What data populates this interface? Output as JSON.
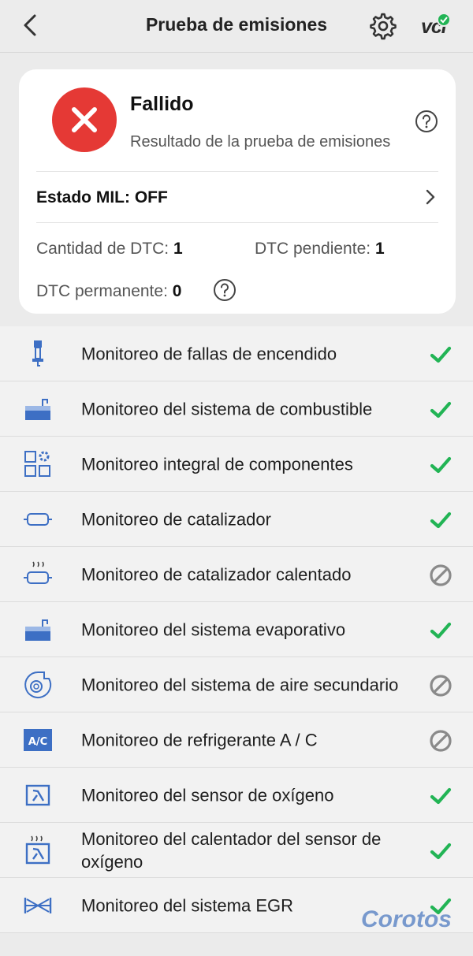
{
  "header": {
    "title": "Prueba de emisiones",
    "vci_label": "vci",
    "vci_status_color": "#22b455"
  },
  "summary": {
    "result_title": "Fallido",
    "result_subtitle": "Resultado de la prueba de emisiones",
    "result_color": "#e53935",
    "mil_status": "Estado MIL: OFF",
    "dtc_count_label": "Cantidad de DTC:",
    "dtc_count_value": "1",
    "dtc_pending_label": "DTC pendiente:",
    "dtc_pending_value": "1",
    "dtc_permanent_label": "DTC permanente:",
    "dtc_permanent_value": "0"
  },
  "monitors": [
    {
      "label": "Monitoreo de fallas de encendido",
      "icon": "spark-plug-icon",
      "status": "complete"
    },
    {
      "label": "Monitoreo del sistema de combustible",
      "icon": "fuel-system-icon",
      "status": "complete"
    },
    {
      "label": "Monitoreo integral de componentes",
      "icon": "components-icon",
      "status": "complete"
    },
    {
      "label": "Monitoreo de catalizador",
      "icon": "catalyst-icon",
      "status": "complete"
    },
    {
      "label": "Monitoreo de catalizador calentado",
      "icon": "heated-catalyst-icon",
      "status": "not-supported"
    },
    {
      "label": "Monitoreo del sistema evaporativo",
      "icon": "evaporative-system-icon",
      "status": "complete"
    },
    {
      "label": "Monitoreo del sistema de aire secundario",
      "icon": "secondary-air-icon",
      "status": "not-supported"
    },
    {
      "label": "Monitoreo de refrigerante A / C",
      "icon": "ac-refrigerant-icon",
      "icon_text": "A/C",
      "status": "not-supported"
    },
    {
      "label": "Monitoreo del sensor de oxígeno",
      "icon": "oxygen-sensor-icon",
      "status": "complete"
    },
    {
      "label": "Monitoreo del calentador del sensor de oxígeno",
      "icon": "oxygen-sensor-heater-icon",
      "status": "complete"
    },
    {
      "label": "Monitoreo del sistema EGR",
      "icon": "egr-system-icon",
      "status": "complete"
    }
  ],
  "colors": {
    "complete": "#22b455",
    "not_supported": "#8a8a8a",
    "icon_blue": "#3d6fc4"
  },
  "watermark": "Corotos"
}
